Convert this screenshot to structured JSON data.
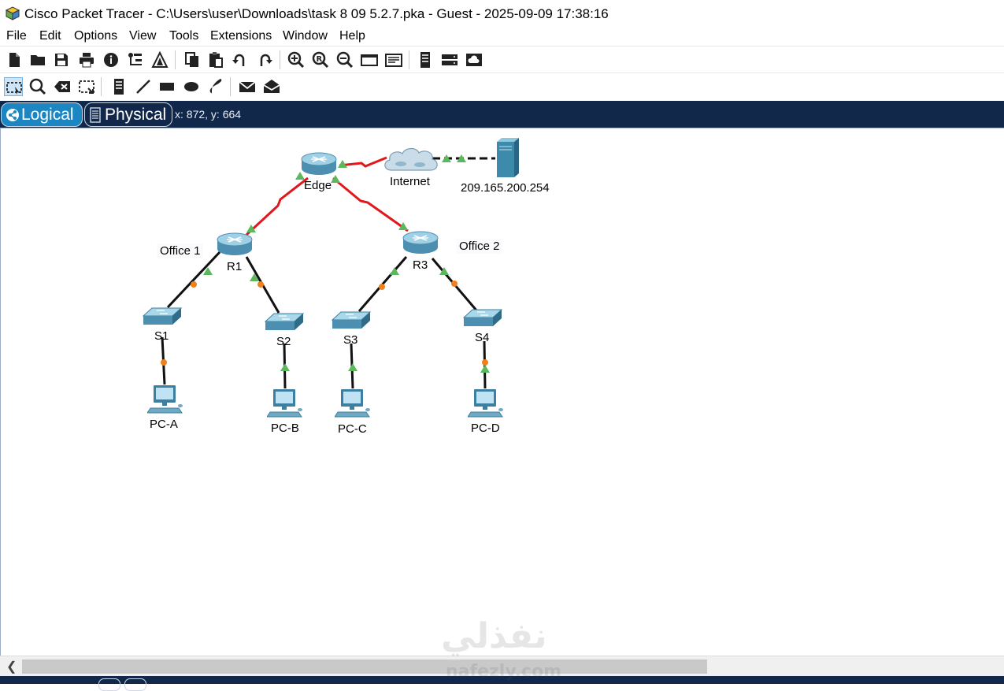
{
  "window": {
    "title": "Cisco Packet Tracer - C:\\Users\\user\\Downloads\\task 8 09 5.2.7.pka - Guest - 2025-09-09 17:38:16"
  },
  "menu": [
    "File",
    "Edit",
    "Options",
    "View",
    "Tools",
    "Extensions",
    "Window",
    "Help"
  ],
  "tabs": {
    "logical": "Logical",
    "physical": "Physical",
    "active": "logical"
  },
  "cursor_readout": "x: 872, y: 664",
  "devices": {
    "edge": "Edge",
    "internet": "Internet",
    "server": "209.165.200.254",
    "r1": "R1",
    "r3": "R3",
    "s1": "S1",
    "s2": "S2",
    "s3": "S3",
    "s4": "S4",
    "pca": "PC-A",
    "pcb": "PC-B",
    "pcc": "PC-C",
    "pcd": "PC-D"
  },
  "notes": {
    "office1": "Office 1",
    "office2": "Office 2"
  },
  "watermark": {
    "arabic": "نفذلي",
    "latin": "nafezly.com"
  },
  "colors": {
    "serial_link": "#e0171b",
    "link_up": "#5bb85d",
    "link_pending": "#f07f1e",
    "tab_bar": "#12284b",
    "tab_active": "#1b86c1"
  }
}
